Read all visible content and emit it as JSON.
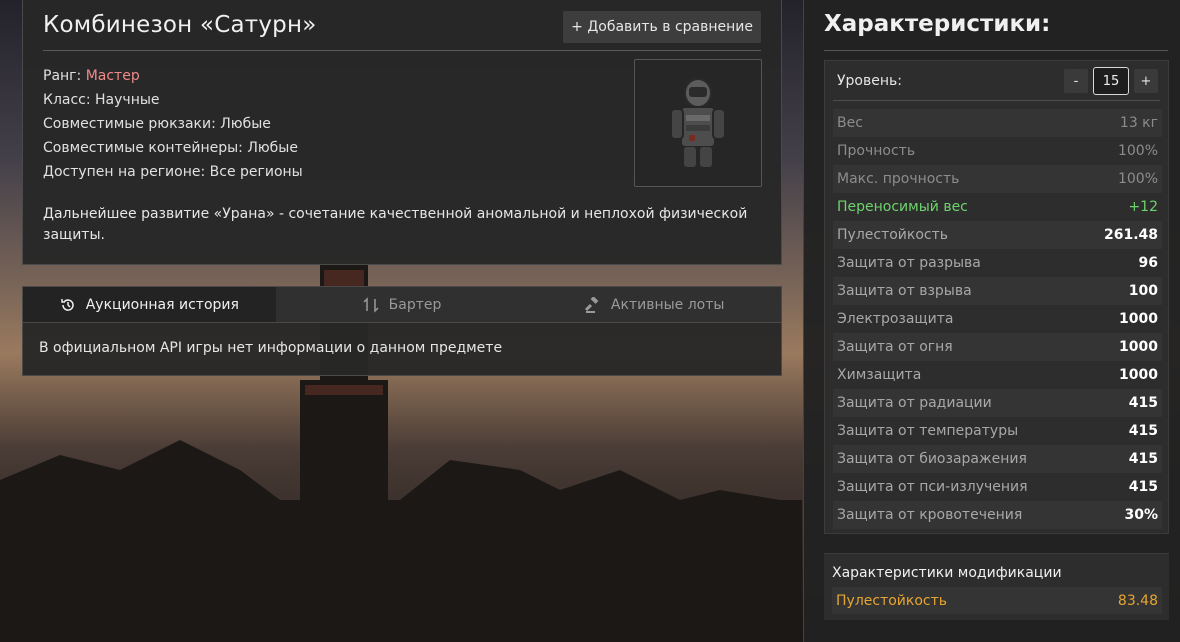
{
  "item": {
    "title": "Комбинезон «Сатурн»",
    "compare_label": "+ Добавить в сравнение",
    "rank_label": "Ранг:",
    "rank_value": "Мастер",
    "class_line": "Класс: Научные",
    "backpacks_line": "Совместимые рюкзаки: Любые",
    "containers_line": "Совместимые контейнеры: Любые",
    "region_line": "Доступен на регионе: Все регионы",
    "description": "Дальнейшее развитие «Урана» - сочетание качественной аномальной и неплохой физической защиты."
  },
  "tabs": {
    "items": [
      {
        "label": "Аукционная история",
        "icon": "history-icon"
      },
      {
        "label": "Бартер",
        "icon": "swap-icon"
      },
      {
        "label": "Активные лоты",
        "icon": "gavel-icon"
      }
    ],
    "body_text": "В официальном API игры нет информации о данном предмете"
  },
  "stats": {
    "title": "Характеристики:",
    "level_label": "Уровень:",
    "level_minus": "-",
    "level_value": "15",
    "level_plus": "+",
    "rows": [
      {
        "name": "Вес",
        "value": "13 кг",
        "style": "muted"
      },
      {
        "name": "Прочность",
        "value": "100%",
        "style": "muted"
      },
      {
        "name": "Макс. прочность",
        "value": "100%",
        "style": "muted"
      },
      {
        "name": "Переносимый вес",
        "value": "+12",
        "style": "green"
      },
      {
        "name": "Пулестойкость",
        "value": "261.48",
        "style": "normal"
      },
      {
        "name": "Защита от разрыва",
        "value": "96",
        "style": "normal"
      },
      {
        "name": "Защита от взрыва",
        "value": "100",
        "style": "normal"
      },
      {
        "name": "Электрозащита",
        "value": "1000",
        "style": "normal"
      },
      {
        "name": "Защита от огня",
        "value": "1000",
        "style": "normal"
      },
      {
        "name": "Химзащита",
        "value": "1000",
        "style": "normal"
      },
      {
        "name": "Защита от радиации",
        "value": "415",
        "style": "normal"
      },
      {
        "name": "Защита от температуры",
        "value": "415",
        "style": "normal"
      },
      {
        "name": "Защита от биозаражения",
        "value": "415",
        "style": "normal"
      },
      {
        "name": "Защита от пси-излучения",
        "value": "415",
        "style": "normal"
      },
      {
        "name": "Защита от кровотечения",
        "value": "30%",
        "style": "normal"
      }
    ]
  },
  "mods": {
    "title": "Характеристики модификации",
    "row_name": "Пулестойкость",
    "row_value": "83.48"
  },
  "colors": {
    "rank": "#f08a8a",
    "positive": "#6dd36d",
    "mod_accent": "#e6a530"
  }
}
